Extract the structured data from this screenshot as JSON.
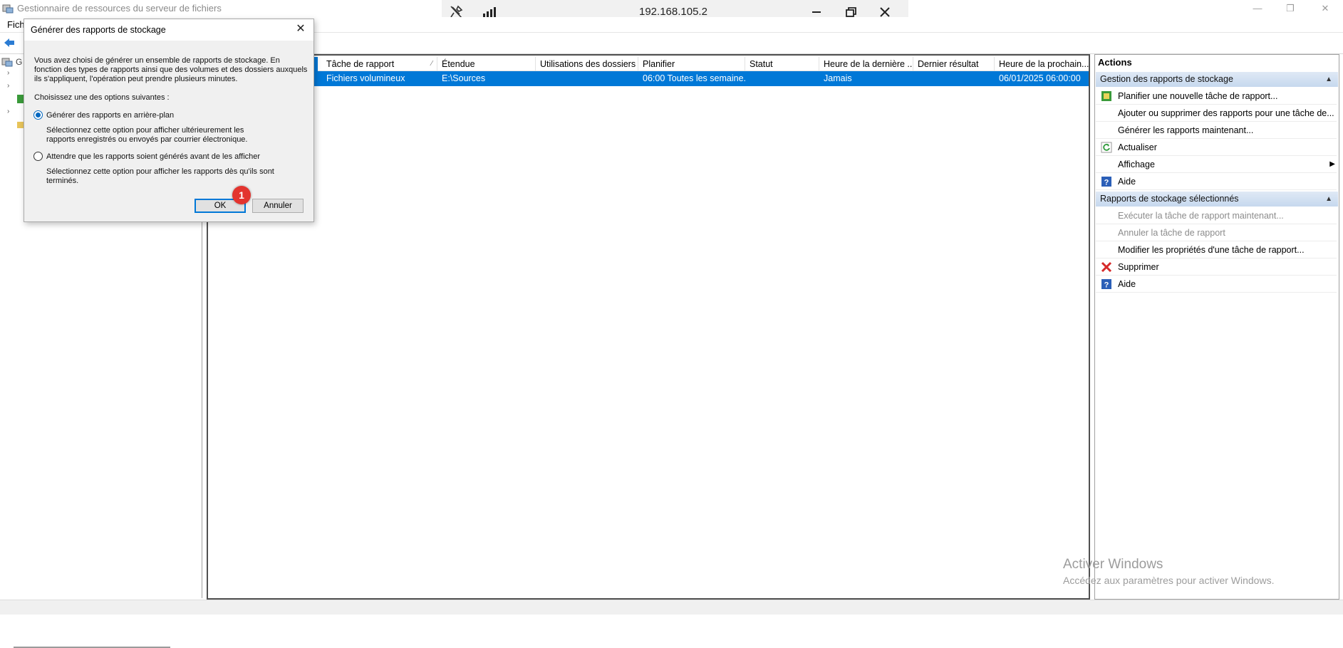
{
  "window": {
    "title": "Gestionnaire de ressources du serveur de fichiers",
    "menu_first": "Fichi"
  },
  "remote_bar": {
    "ip": "192.168.105.2"
  },
  "tree": {
    "root_fragment": "G"
  },
  "list": {
    "headers": [
      "Tâche de rapport",
      "Étendue",
      "Utilisations des dossiers",
      "Planifier",
      "Statut",
      "Heure de la dernière ...",
      "Dernier résultat",
      "Heure de la prochain..."
    ],
    "rows": [
      {
        "task": "Fichiers volumineux",
        "scope": "E:\\Sources",
        "usage": "",
        "schedule": "06:00 Toutes les semaine...",
        "status": "",
        "last_time": "Jamais",
        "last_result": "",
        "next_time": "06/01/2025 06:00:00"
      }
    ]
  },
  "actions": {
    "title": "Actions",
    "section1": {
      "title": "Gestion des rapports de stockage",
      "items": [
        "Planifier une nouvelle tâche de rapport...",
        "Ajouter ou supprimer des rapports pour une tâche de...",
        "Générer les rapports maintenant...",
        "Actualiser",
        "Affichage",
        "Aide"
      ]
    },
    "section2": {
      "title": "Rapports de stockage sélectionnés",
      "items": [
        "Exécuter la tâche de rapport maintenant...",
        "Annuler la tâche de rapport",
        "Modifier les propriétés d'une tâche de rapport...",
        "Supprimer",
        "Aide"
      ]
    }
  },
  "watermark": {
    "line1": "Activer Windows",
    "line2": "Accédez aux paramètres pour activer Windows."
  },
  "dialog": {
    "title": "Générer des rapports de stockage",
    "intro": "Vous avez choisi de générer un ensemble de rapports de stockage. En fonction des types de rapports ainsi que des volumes et des dossiers auxquels ils s'appliquent, l'opération peut prendre plusieurs minutes.",
    "prompt": "Choisissez une des options suivantes :",
    "option1": {
      "label": "Générer des rapports en arrière-plan",
      "description": "Sélectionnez cette option pour afficher ultérieurement les rapports enregistrés ou envoyés par courrier électronique.",
      "checked": true
    },
    "option2": {
      "label": "Attendre que les rapports soient générés avant de les afficher",
      "description": "Sélectionnez cette option pour afficher les rapports dès qu'ils sont terminés.",
      "checked": false
    },
    "ok_label": "OK",
    "cancel_label": "Annuler",
    "step_badge": "1"
  },
  "colors": {
    "selection": "#0078d7",
    "section_header": "#c6d8ee",
    "badge": "#e3342f"
  }
}
